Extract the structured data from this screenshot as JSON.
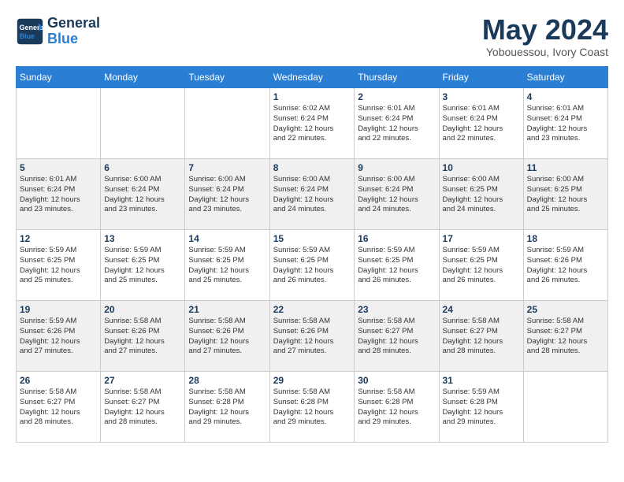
{
  "header": {
    "logo_line1": "General",
    "logo_line2": "Blue",
    "month": "May 2024",
    "location": "Yobouessou, Ivory Coast"
  },
  "weekdays": [
    "Sunday",
    "Monday",
    "Tuesday",
    "Wednesday",
    "Thursday",
    "Friday",
    "Saturday"
  ],
  "weeks": [
    [
      {
        "day": "",
        "info": ""
      },
      {
        "day": "",
        "info": ""
      },
      {
        "day": "",
        "info": ""
      },
      {
        "day": "1",
        "info": "Sunrise: 6:02 AM\nSunset: 6:24 PM\nDaylight: 12 hours\nand 22 minutes."
      },
      {
        "day": "2",
        "info": "Sunrise: 6:01 AM\nSunset: 6:24 PM\nDaylight: 12 hours\nand 22 minutes."
      },
      {
        "day": "3",
        "info": "Sunrise: 6:01 AM\nSunset: 6:24 PM\nDaylight: 12 hours\nand 22 minutes."
      },
      {
        "day": "4",
        "info": "Sunrise: 6:01 AM\nSunset: 6:24 PM\nDaylight: 12 hours\nand 23 minutes."
      }
    ],
    [
      {
        "day": "5",
        "info": "Sunrise: 6:01 AM\nSunset: 6:24 PM\nDaylight: 12 hours\nand 23 minutes."
      },
      {
        "day": "6",
        "info": "Sunrise: 6:00 AM\nSunset: 6:24 PM\nDaylight: 12 hours\nand 23 minutes."
      },
      {
        "day": "7",
        "info": "Sunrise: 6:00 AM\nSunset: 6:24 PM\nDaylight: 12 hours\nand 23 minutes."
      },
      {
        "day": "8",
        "info": "Sunrise: 6:00 AM\nSunset: 6:24 PM\nDaylight: 12 hours\nand 24 minutes."
      },
      {
        "day": "9",
        "info": "Sunrise: 6:00 AM\nSunset: 6:24 PM\nDaylight: 12 hours\nand 24 minutes."
      },
      {
        "day": "10",
        "info": "Sunrise: 6:00 AM\nSunset: 6:25 PM\nDaylight: 12 hours\nand 24 minutes."
      },
      {
        "day": "11",
        "info": "Sunrise: 6:00 AM\nSunset: 6:25 PM\nDaylight: 12 hours\nand 25 minutes."
      }
    ],
    [
      {
        "day": "12",
        "info": "Sunrise: 5:59 AM\nSunset: 6:25 PM\nDaylight: 12 hours\nand 25 minutes."
      },
      {
        "day": "13",
        "info": "Sunrise: 5:59 AM\nSunset: 6:25 PM\nDaylight: 12 hours\nand 25 minutes."
      },
      {
        "day": "14",
        "info": "Sunrise: 5:59 AM\nSunset: 6:25 PM\nDaylight: 12 hours\nand 25 minutes."
      },
      {
        "day": "15",
        "info": "Sunrise: 5:59 AM\nSunset: 6:25 PM\nDaylight: 12 hours\nand 26 minutes."
      },
      {
        "day": "16",
        "info": "Sunrise: 5:59 AM\nSunset: 6:25 PM\nDaylight: 12 hours\nand 26 minutes."
      },
      {
        "day": "17",
        "info": "Sunrise: 5:59 AM\nSunset: 6:25 PM\nDaylight: 12 hours\nand 26 minutes."
      },
      {
        "day": "18",
        "info": "Sunrise: 5:59 AM\nSunset: 6:26 PM\nDaylight: 12 hours\nand 26 minutes."
      }
    ],
    [
      {
        "day": "19",
        "info": "Sunrise: 5:59 AM\nSunset: 6:26 PM\nDaylight: 12 hours\nand 27 minutes."
      },
      {
        "day": "20",
        "info": "Sunrise: 5:58 AM\nSunset: 6:26 PM\nDaylight: 12 hours\nand 27 minutes."
      },
      {
        "day": "21",
        "info": "Sunrise: 5:58 AM\nSunset: 6:26 PM\nDaylight: 12 hours\nand 27 minutes."
      },
      {
        "day": "22",
        "info": "Sunrise: 5:58 AM\nSunset: 6:26 PM\nDaylight: 12 hours\nand 27 minutes."
      },
      {
        "day": "23",
        "info": "Sunrise: 5:58 AM\nSunset: 6:27 PM\nDaylight: 12 hours\nand 28 minutes."
      },
      {
        "day": "24",
        "info": "Sunrise: 5:58 AM\nSunset: 6:27 PM\nDaylight: 12 hours\nand 28 minutes."
      },
      {
        "day": "25",
        "info": "Sunrise: 5:58 AM\nSunset: 6:27 PM\nDaylight: 12 hours\nand 28 minutes."
      }
    ],
    [
      {
        "day": "26",
        "info": "Sunrise: 5:58 AM\nSunset: 6:27 PM\nDaylight: 12 hours\nand 28 minutes."
      },
      {
        "day": "27",
        "info": "Sunrise: 5:58 AM\nSunset: 6:27 PM\nDaylight: 12 hours\nand 28 minutes."
      },
      {
        "day": "28",
        "info": "Sunrise: 5:58 AM\nSunset: 6:28 PM\nDaylight: 12 hours\nand 29 minutes."
      },
      {
        "day": "29",
        "info": "Sunrise: 5:58 AM\nSunset: 6:28 PM\nDaylight: 12 hours\nand 29 minutes."
      },
      {
        "day": "30",
        "info": "Sunrise: 5:58 AM\nSunset: 6:28 PM\nDaylight: 12 hours\nand 29 minutes."
      },
      {
        "day": "31",
        "info": "Sunrise: 5:59 AM\nSunset: 6:28 PM\nDaylight: 12 hours\nand 29 minutes."
      },
      {
        "day": "",
        "info": ""
      }
    ]
  ]
}
